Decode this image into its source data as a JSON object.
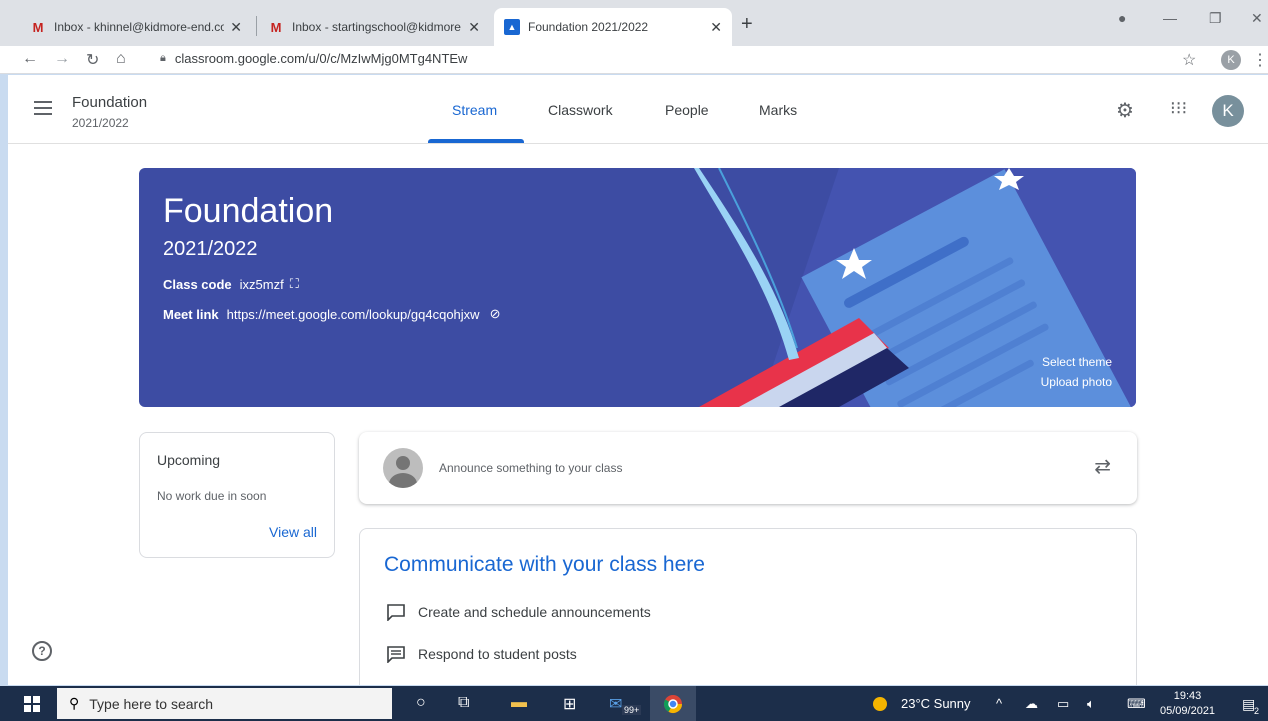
{
  "browser": {
    "tabs": [
      {
        "title": "Inbox - khinnel@kidmore-end.co",
        "icon": "gmail-icon"
      },
      {
        "title": "Inbox - startingschool@kidmore",
        "icon": "gmail-icon"
      },
      {
        "title": "Foundation 2021/2022",
        "icon": "classroom-icon"
      }
    ],
    "url": "classroom.google.com/u/0/c/MzIwMjg0MTg4NTEw",
    "profile_initial": "K"
  },
  "header": {
    "class_name": "Foundation",
    "class_year": "2021/2022",
    "tabs": [
      "Stream",
      "Classwork",
      "People",
      "Marks"
    ],
    "active_tab": "Stream",
    "avatar_initial": "K"
  },
  "banner": {
    "title": "Foundation",
    "subtitle": "2021/2022",
    "class_code_label": "Class code",
    "class_code": "ixz5mzf",
    "meet_link_label": "Meet link",
    "meet_link": "https://meet.google.com/lookup/gq4cqohjxw",
    "select_theme": "Select theme",
    "upload_photo": "Upload photo"
  },
  "upcoming": {
    "title": "Upcoming",
    "text": "No work due in soon",
    "view_all": "View all"
  },
  "announce": {
    "placeholder": "Announce something to your class"
  },
  "communicate": {
    "title": "Communicate with your class here",
    "items": [
      "Create and schedule announcements",
      "Respond to student posts"
    ]
  },
  "taskbar": {
    "search_placeholder": "Type here to search",
    "badge": "99+",
    "weather": "23°C  Sunny",
    "time": "19:43",
    "date": "05/09/2021",
    "notif_count": "2"
  },
  "colors": {
    "accent": "#1967d2",
    "banner": "#3d4ca3",
    "taskbar": "#1c2e4a"
  }
}
